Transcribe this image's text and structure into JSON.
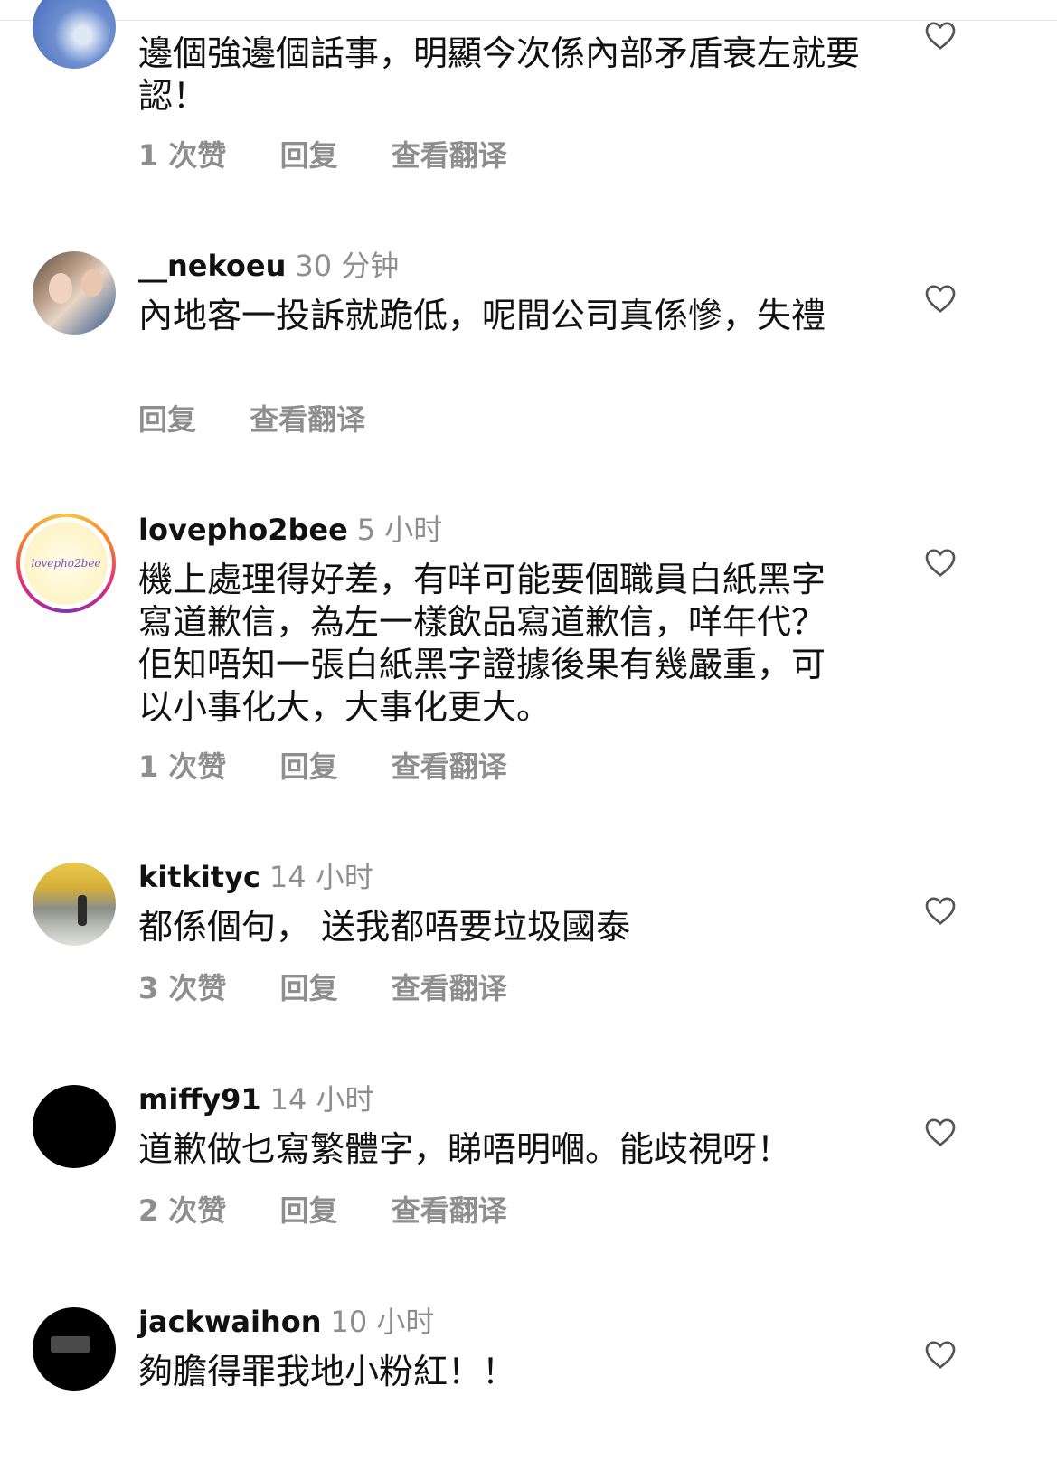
{
  "comments": [
    {
      "user": "",
      "time": "",
      "text": "邊個強邊個話事，明顯今次係內部矛盾衰左就要認！",
      "likes": "1 次赞",
      "reply": "回复",
      "translate": "查看翻译"
    },
    {
      "user": "__nekoeu",
      "time": "30 分钟",
      "text": "內地客一投訴就跪低，呢間公司真係慘，失禮",
      "likes": "",
      "reply": "回复",
      "translate": "查看翻译"
    },
    {
      "user": "lovepho2bee",
      "avatar_text": "lovepho2bee",
      "time": "5 小时",
      "text": "機上處理得好差，有咩可能要個職員白紙黑字寫道歉信，為左一樣飲品寫道歉信，咩年代？佢知唔知一張白紙黑字證據後果有幾嚴重，可以小事化大，大事化更大。",
      "likes": "1 次赞",
      "reply": "回复",
      "translate": "查看翻译"
    },
    {
      "user": "kitkityc",
      "time": "14 小时",
      "text": "都係個句， 送我都唔要垃圾國泰",
      "likes": "3 次赞",
      "reply": "回复",
      "translate": "查看翻译"
    },
    {
      "user": "miffy91",
      "time": "14 小时",
      "text": "道歉做乜寫繁體字，睇唔明嗰。能歧視呀！",
      "likes": "2 次赞",
      "reply": "回复",
      "translate": "查看翻译"
    },
    {
      "user": "jackwaihon",
      "time": "10 小时",
      "text": "夠膽得罪我地小粉紅！！",
      "likes": "",
      "reply": "",
      "translate": ""
    }
  ],
  "icons": {
    "like": "heart-outline-icon"
  },
  "colors": {
    "secondary_text": "#8e8e8e",
    "primary_text": "#111111"
  }
}
